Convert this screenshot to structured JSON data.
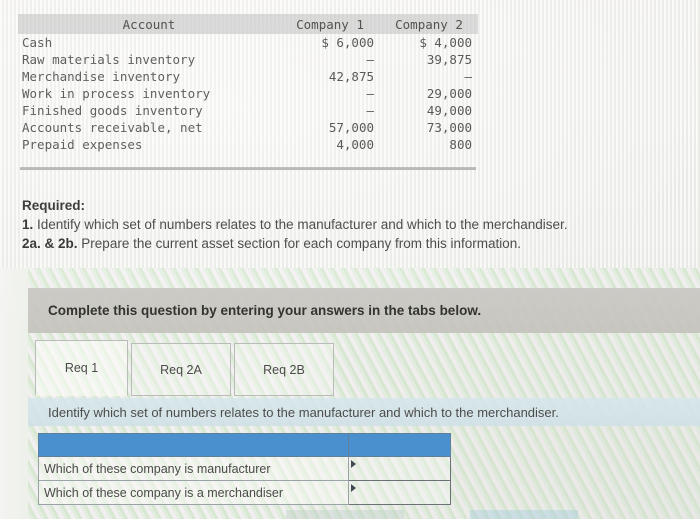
{
  "accounts_table": {
    "headers": [
      "Account",
      "Company 1",
      "Company 2"
    ],
    "rows": [
      {
        "account": "Cash",
        "company1": "$ 6,000",
        "company2": "$ 4,000"
      },
      {
        "account": "Raw materials inventory",
        "company1": "–",
        "company2": "39,875"
      },
      {
        "account": "Merchandise inventory",
        "company1": "42,875",
        "company2": "–"
      },
      {
        "account": "Work in process inventory",
        "company1": "–",
        "company2": "29,000"
      },
      {
        "account": "Finished goods inventory",
        "company1": "–",
        "company2": "49,000"
      },
      {
        "account": "Accounts receivable, net",
        "company1": "57,000",
        "company2": "73,000"
      },
      {
        "account": "Prepaid expenses",
        "company1": "4,000",
        "company2": "800"
      }
    ]
  },
  "required": {
    "heading": "Required:",
    "item1_number": "1.",
    "item1_text": "Identify which set of numbers relates to the manufacturer and which to the merchandiser.",
    "item2_number": "2a. & 2b.",
    "item2_text": "Prepare the current asset section for each company from this information."
  },
  "complete_bar": {
    "text": "Complete this question by entering your answers in the tabs below."
  },
  "tabs": [
    {
      "label": "Req 1",
      "active": true
    },
    {
      "label": "Req 2A",
      "active": false
    },
    {
      "label": "Req 2B",
      "active": false
    }
  ],
  "prompt": {
    "text": "Identify which set of numbers relates to the manufacturer and which to the merchandiser."
  },
  "answer_grid": {
    "header_left": "",
    "header_right": "",
    "rows": [
      {
        "label": "Which of these company is manufacturer",
        "value": ""
      },
      {
        "label": "Which of these company is a merchandiser",
        "value": ""
      }
    ]
  },
  "colors": {
    "header_blue": "#4a90cf",
    "prompt_band": "#d6e6ec",
    "complete_bar": "#cac8c3",
    "table_header_grey": "#c4c6c4"
  }
}
